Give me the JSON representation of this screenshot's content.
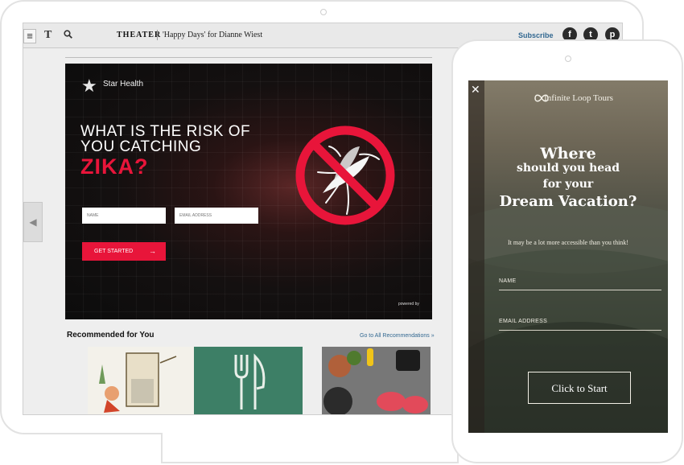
{
  "tablet": {
    "topbar": {
      "menu_icon": "menu-icon",
      "logo": "T",
      "search_icon": "search-icon",
      "section": "THEATER",
      "article_title": "'Happy Days' for Dianne Wiest",
      "subscribe": "Subscribe",
      "social": {
        "facebook": "f",
        "twitter": "t",
        "pinterest": "p"
      }
    },
    "side_arrow": "◀",
    "ad": {
      "brand": "Star Health",
      "headline_line1": "WHAT IS THE RISK OF",
      "headline_line2": "YOU CATCHING",
      "headline_accent": "ZIKA?",
      "name_placeholder": "NAME",
      "email_placeholder": "EMAIL ADDRESS",
      "cta_label": "GET STARTED",
      "cta_arrow": "→",
      "powered_by": "powered by",
      "accent_color": "#e8153a"
    },
    "recommended": {
      "heading": "Recommended for You",
      "all_link": "Go to All Recommendations »"
    }
  },
  "phone": {
    "close": "✕",
    "brand": "Infinite Loop Tours",
    "headline_line1": "Where",
    "headline_line2": "should you head",
    "headline_line3": "for your",
    "headline_line4": "Dream Vacation?",
    "subtext": "It may be a lot more accessible than you think!",
    "name_label": "NAME",
    "email_label": "EMAIL ADDRESS",
    "cta_label": "Click to Start"
  }
}
